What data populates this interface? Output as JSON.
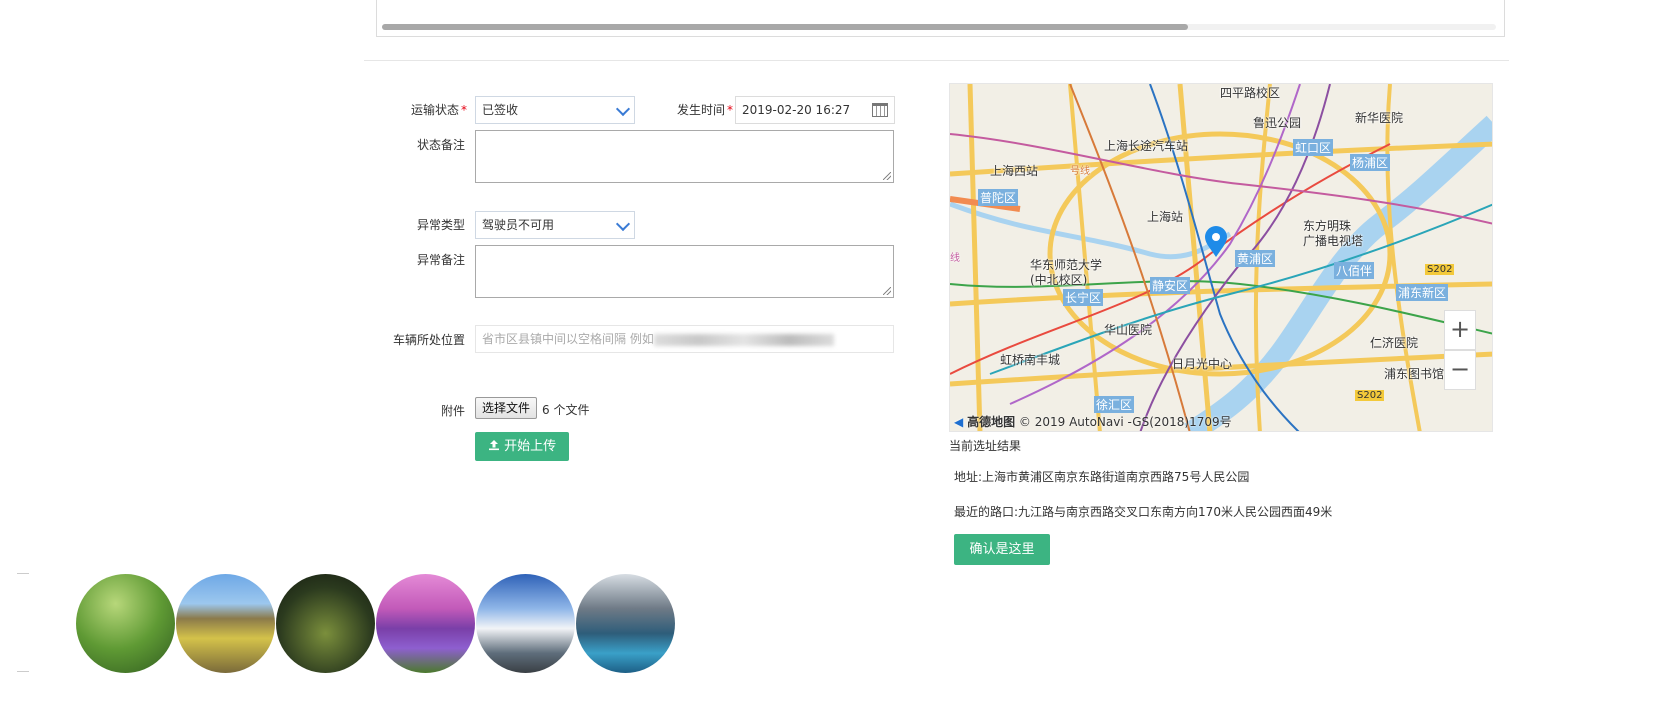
{
  "form": {
    "transport_status_label": "运输状态",
    "transport_status_value": "已签收",
    "occur_time_label": "发生时间",
    "occur_time_value": "2019-02-20 16:27",
    "status_remark_label": "状态备注",
    "exception_type_label": "异常类型",
    "exception_type_value": "驾驶员不可用",
    "exception_remark_label": "异常备注",
    "location_label": "车辆所处位置",
    "location_placeholder": "省市区县镇中间以空格间隔 例如",
    "required_mark": "*",
    "attachment_label": "附件",
    "choose_file_label": "选择文件",
    "file_count_text": "6 个文件",
    "upload_button_label": "开始上传"
  },
  "map": {
    "labels": {
      "siping": "四平路校区",
      "luxun_park": "鲁迅公园",
      "xinhua_hospital": "新华医院",
      "hongkou": "虹口区",
      "yangpu": "杨浦区",
      "long_distance_station": "上海长途汽车站",
      "shanghai_west": "上海西站",
      "putuo": "普陀区",
      "shanghai_station": "上海站",
      "oriental_pearl_1": "东方明珠",
      "oriental_pearl_2": "广播电视塔",
      "huangpu": "黄浦区",
      "bapuqiao": "八佰伴",
      "ecnu_1": "华东师范大学",
      "ecnu_2": "(中北校区)",
      "changning": "长宁区",
      "jingan": "静安区",
      "pudong": "浦东新区",
      "huashan_hospital": "华山医院",
      "renji_hospital": "仁济医院",
      "hongqiao_mall": "虹桥南丰城",
      "sun_moon": "日月光中心",
      "pudong_library": "浦东图书馆",
      "xuhui": "徐汇区",
      "s202a": "S202",
      "s202b": "S202",
      "hao_xian": "号线",
      "xian": "线"
    },
    "zoom_in": "+",
    "zoom_out": "−",
    "brand": "高德地图",
    "copyright": "© 2019 AutoNavi -GS(2018)1709号"
  },
  "result": {
    "title": "当前选址结果",
    "address": "地址:上海市黄浦区南京东路街道南京西路75号人民公园",
    "nearest_road": "最近的路口:九江路与南京西路交叉口东南方向170米人民公园西面49米",
    "confirm_label": "确认是这里"
  },
  "colors": {
    "primary_green": "#3cb482",
    "required_red": "#e60012",
    "select_chevron": "#3a7bd5"
  }
}
